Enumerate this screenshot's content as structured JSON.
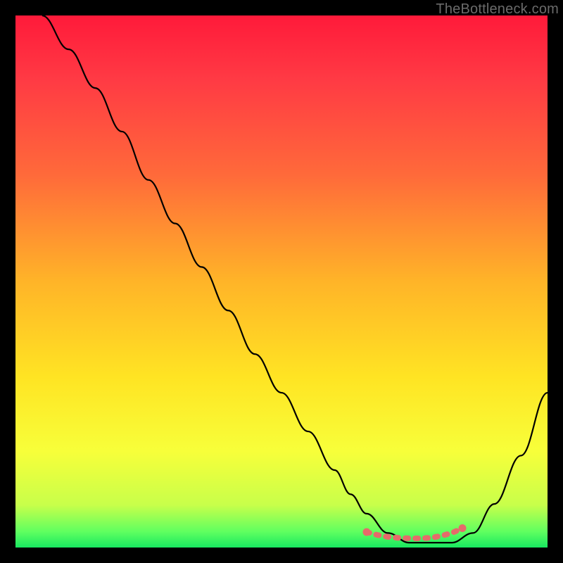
{
  "watermark": "TheBottleneck.com",
  "chart_data": {
    "type": "line",
    "title": "",
    "xlabel": "",
    "ylabel": "",
    "xlim": [
      0,
      100
    ],
    "ylim": [
      0,
      110
    ],
    "series": [
      {
        "name": "curve",
        "x": [
          5,
          10,
          15,
          20,
          25,
          30,
          35,
          40,
          45,
          50,
          55,
          60,
          63,
          66,
          70,
          74,
          78,
          82,
          86,
          90,
          95,
          100
        ],
        "y": [
          110,
          103,
          95,
          86,
          76,
          67,
          58,
          49,
          40,
          32,
          24,
          16,
          11,
          7,
          3,
          1,
          1,
          1,
          3,
          9,
          19,
          32
        ]
      },
      {
        "name": "marker-band",
        "x": [
          66,
          68,
          70,
          72,
          74,
          76,
          78,
          80,
          82,
          84
        ],
        "y": [
          3.2,
          2.6,
          2.2,
          2.0,
          1.9,
          1.9,
          2.0,
          2.4,
          3.0,
          4.0
        ]
      }
    ],
    "gradient_stops": [
      {
        "offset": 0.0,
        "color": "#ff1a3a"
      },
      {
        "offset": 0.12,
        "color": "#ff3a44"
      },
      {
        "offset": 0.3,
        "color": "#ff6a3a"
      },
      {
        "offset": 0.5,
        "color": "#ffb428"
      },
      {
        "offset": 0.68,
        "color": "#ffe423"
      },
      {
        "offset": 0.82,
        "color": "#f7ff3a"
      },
      {
        "offset": 0.92,
        "color": "#c8ff4a"
      },
      {
        "offset": 0.97,
        "color": "#60ff60"
      },
      {
        "offset": 1.0,
        "color": "#18e860"
      }
    ],
    "marker_color": "#e66a6a"
  }
}
